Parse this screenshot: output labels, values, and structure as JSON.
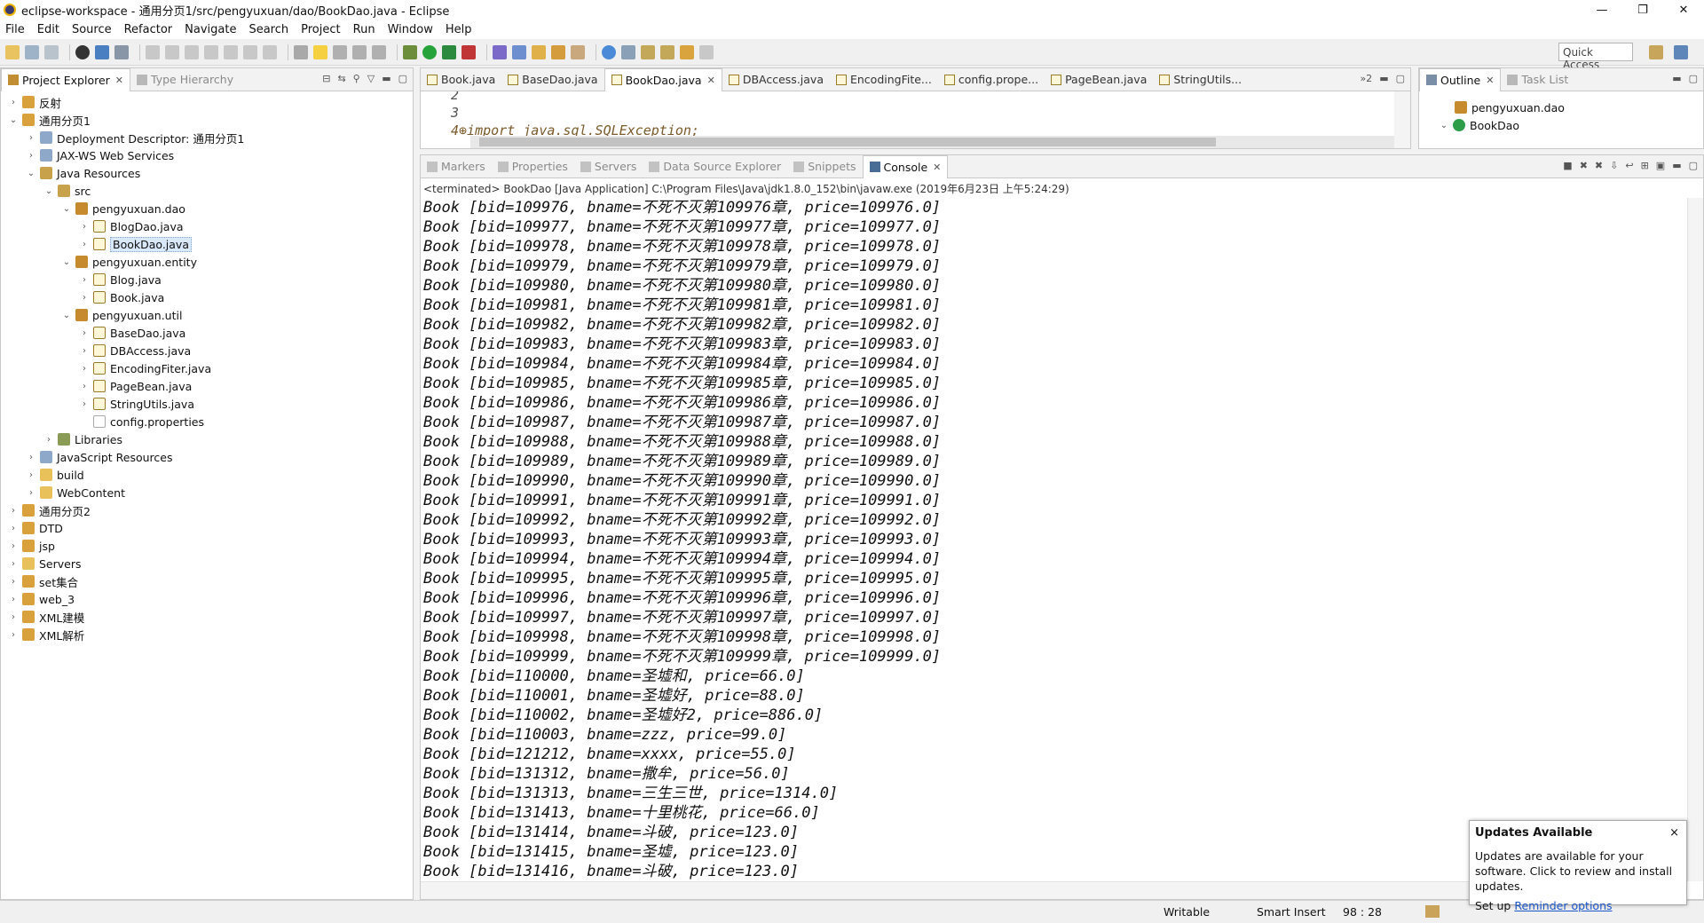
{
  "window": {
    "title": "eclipse-workspace - 通用分页1/src/pengyuxuan/dao/BookDao.java - Eclipse",
    "minimize": "—",
    "maximize": "❐",
    "close": "✕"
  },
  "menu": [
    "File",
    "Edit",
    "Source",
    "Refactor",
    "Navigate",
    "Search",
    "Project",
    "Run",
    "Window",
    "Help"
  ],
  "toolbar": {
    "quick_access": "Quick Access"
  },
  "project_explorer": {
    "tabs": [
      {
        "label": "Project Explorer",
        "close": "✕"
      },
      {
        "label": "Type Hierarchy"
      }
    ],
    "tree": [
      {
        "label": "反射",
        "level": 0,
        "arrow": "›",
        "icon": "proj"
      },
      {
        "label": "通用分页1",
        "level": 0,
        "arrow": "⌄",
        "icon": "proj"
      },
      {
        "label": "Deployment Descriptor: 通用分页1",
        "level": 1,
        "arrow": "›",
        "icon": "jar"
      },
      {
        "label": "JAX-WS Web Services",
        "level": 1,
        "arrow": "›",
        "icon": "jar"
      },
      {
        "label": "Java Resources",
        "level": 1,
        "arrow": "⌄",
        "icon": "src"
      },
      {
        "label": "src",
        "level": 2,
        "arrow": "⌄",
        "icon": "src"
      },
      {
        "label": "pengyuxuan.dao",
        "level": 3,
        "arrow": "⌄",
        "icon": "pkg"
      },
      {
        "label": "BlogDao.java",
        "level": 4,
        "arrow": "›",
        "icon": "java"
      },
      {
        "label": "BookDao.java",
        "level": 4,
        "arrow": "›",
        "icon": "java",
        "selected": true
      },
      {
        "label": "pengyuxuan.entity",
        "level": 3,
        "arrow": "⌄",
        "icon": "pkg"
      },
      {
        "label": "Blog.java",
        "level": 4,
        "arrow": "›",
        "icon": "java"
      },
      {
        "label": "Book.java",
        "level": 4,
        "arrow": "›",
        "icon": "java"
      },
      {
        "label": "pengyuxuan.util",
        "level": 3,
        "arrow": "⌄",
        "icon": "pkg"
      },
      {
        "label": "BaseDao.java",
        "level": 4,
        "arrow": "›",
        "icon": "java"
      },
      {
        "label": "DBAccess.java",
        "level": 4,
        "arrow": "›",
        "icon": "java"
      },
      {
        "label": "EncodingFiter.java",
        "level": 4,
        "arrow": "›",
        "icon": "java"
      },
      {
        "label": "PageBean.java",
        "level": 4,
        "arrow": "›",
        "icon": "java"
      },
      {
        "label": "StringUtils.java",
        "level": 4,
        "arrow": "›",
        "icon": "java"
      },
      {
        "label": "config.properties",
        "level": 4,
        "arrow": "",
        "icon": "prop"
      },
      {
        "label": "Libraries",
        "level": 2,
        "arrow": "›",
        "icon": "lib"
      },
      {
        "label": "JavaScript Resources",
        "level": 1,
        "arrow": "›",
        "icon": "jar"
      },
      {
        "label": "build",
        "level": 1,
        "arrow": "›",
        "icon": "fold"
      },
      {
        "label": "WebContent",
        "level": 1,
        "arrow": "›",
        "icon": "fold"
      },
      {
        "label": "通用分页2",
        "level": 0,
        "arrow": "›",
        "icon": "proj"
      },
      {
        "label": "DTD",
        "level": 0,
        "arrow": "›",
        "icon": "proj"
      },
      {
        "label": "jsp",
        "level": 0,
        "arrow": "›",
        "icon": "proj"
      },
      {
        "label": "Servers",
        "level": 0,
        "arrow": "›",
        "icon": "fold"
      },
      {
        "label": "set集合",
        "level": 0,
        "arrow": "›",
        "icon": "proj"
      },
      {
        "label": "web_3",
        "level": 0,
        "arrow": "›",
        "icon": "proj"
      },
      {
        "label": "XML建模",
        "level": 0,
        "arrow": "›",
        "icon": "proj"
      },
      {
        "label": "XML解析",
        "level": 0,
        "arrow": "›",
        "icon": "proj"
      }
    ]
  },
  "editor": {
    "tabs": [
      "Book.java",
      "BaseDao.java",
      "BookDao.java",
      "DBAccess.java",
      "EncodingFite...",
      "config.prope...",
      "PageBean.java",
      "StringUtils..."
    ],
    "active_tab": "BookDao.java",
    "overflow": "»2",
    "lines": [
      "2",
      "3",
      "4⊕import java.sql.SQLException;"
    ]
  },
  "outline": {
    "tabs": [
      {
        "label": "Outline",
        "close": "✕"
      },
      {
        "label": "Task List"
      }
    ],
    "items": [
      "pengyuxuan.dao",
      "BookDao"
    ]
  },
  "bottom_tabs": [
    "Markers",
    "Properties",
    "Servers",
    "Data Source Explorer",
    "Snippets",
    "Console"
  ],
  "console": {
    "header": "<terminated> BookDao [Java Application] C:\\Program Files\\Java\\jdk1.8.0_152\\bin\\javaw.exe (2019年6月23日 上午5:24:29)",
    "lines": [
      "Book [bid=109976, bname=不死不灭第109976章, price=109976.0]",
      "Book [bid=109977, bname=不死不灭第109977章, price=109977.0]",
      "Book [bid=109978, bname=不死不灭第109978章, price=109978.0]",
      "Book [bid=109979, bname=不死不灭第109979章, price=109979.0]",
      "Book [bid=109980, bname=不死不灭第109980章, price=109980.0]",
      "Book [bid=109981, bname=不死不灭第109981章, price=109981.0]",
      "Book [bid=109982, bname=不死不灭第109982章, price=109982.0]",
      "Book [bid=109983, bname=不死不灭第109983章, price=109983.0]",
      "Book [bid=109984, bname=不死不灭第109984章, price=109984.0]",
      "Book [bid=109985, bname=不死不灭第109985章, price=109985.0]",
      "Book [bid=109986, bname=不死不灭第109986章, price=109986.0]",
      "Book [bid=109987, bname=不死不灭第109987章, price=109987.0]",
      "Book [bid=109988, bname=不死不灭第109988章, price=109988.0]",
      "Book [bid=109989, bname=不死不灭第109989章, price=109989.0]",
      "Book [bid=109990, bname=不死不灭第109990章, price=109990.0]",
      "Book [bid=109991, bname=不死不灭第109991章, price=109991.0]",
      "Book [bid=109992, bname=不死不灭第109992章, price=109992.0]",
      "Book [bid=109993, bname=不死不灭第109993章, price=109993.0]",
      "Book [bid=109994, bname=不死不灭第109994章, price=109994.0]",
      "Book [bid=109995, bname=不死不灭第109995章, price=109995.0]",
      "Book [bid=109996, bname=不死不灭第109996章, price=109996.0]",
      "Book [bid=109997, bname=不死不灭第109997章, price=109997.0]",
      "Book [bid=109998, bname=不死不灭第109998章, price=109998.0]",
      "Book [bid=109999, bname=不死不灭第109999章, price=109999.0]",
      "Book [bid=110000, bname=圣墟和, price=66.0]",
      "Book [bid=110001, bname=圣墟好, price=88.0]",
      "Book [bid=110002, bname=圣墟好2, price=886.0]",
      "Book [bid=110003, bname=zzz, price=99.0]",
      "Book [bid=121212, bname=xxxx, price=55.0]",
      "Book [bid=131312, bname=撒牟, price=56.0]",
      "Book [bid=131313, bname=三生三世, price=1314.0]",
      "Book [bid=131413, bname=十里桃花, price=66.0]",
      "Book [bid=131414, bname=斗破, price=123.0]",
      "Book [bid=131415, bname=圣墟, price=123.0]",
      "Book [bid=131416, bname=斗破, price=123.0]"
    ]
  },
  "status": {
    "mode": "Writable",
    "insert": "Smart Insert",
    "position": "98 : 28"
  },
  "notification": {
    "title": "Updates Available",
    "close": "×",
    "body": "Updates are available for your software. Click to review and install updates.",
    "setup_prefix": "Set up ",
    "link": "Reminder options"
  },
  "colors": {
    "selection": "#d9e8fb",
    "link": "#1a56c8"
  }
}
